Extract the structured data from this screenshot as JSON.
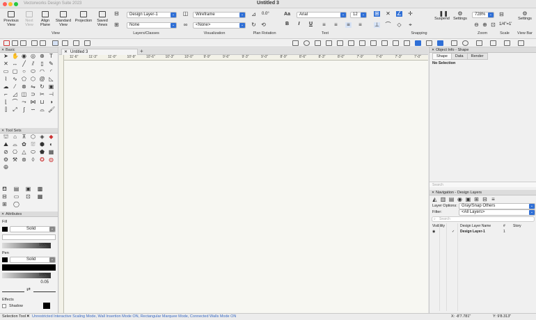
{
  "window": {
    "app_title": "Vectorworks Design Suite 2023",
    "doc_title": "Untitled 3"
  },
  "toolbar": {
    "previous_view": "Previous View",
    "next_view": "Next View",
    "align_plane": "Align Plane",
    "standard_view": "Standard View",
    "projection": "Projection",
    "saved_views": "Saved Views",
    "view_label": "View",
    "design_layer": "Design Layer-1",
    "class_value": "None",
    "layers_classes_label": "Layers/Classes",
    "render_mode": "Wireframe",
    "projection_value": "<None>",
    "visualization_label": "Visualization",
    "plan_rotation_value": "0.0°",
    "plan_rotation_label": "Plan Rotation",
    "font_name": "Arial",
    "font_size": "12",
    "text_label": "Text",
    "snapping_label": "Snapping",
    "suspend": "Suspend",
    "settings": "Settings",
    "zoom_value": "728%",
    "zoom_label": "Zoom",
    "scale_value": "1/4\"=1'",
    "scale_label": "Scale",
    "settings_right": "Settings",
    "view_bar_label": "View Bar"
  },
  "palettes": {
    "basic": "Basic",
    "tool_sets": "Tool Sets",
    "attributes": "Attributes",
    "fill_label": "Fill",
    "fill_style": "Solid",
    "fill_opacity": "100%",
    "pen_label": "Pen",
    "pen_style": "Solid",
    "pen_opacity": "100%",
    "line_weight": "0.05",
    "effects_label": "Effects",
    "shadow_label": "Shadow"
  },
  "document": {
    "tab": "Untitled 3",
    "ruler_ticks": [
      "11'-6\"",
      "11'-3\"",
      "11'-0\"",
      "10'-9\"",
      "10'-6\"",
      "10'-3\"",
      "10'-0\"",
      "9'-9\"",
      "9'-6\"",
      "9'-3\"",
      "9'-0\"",
      "8'-9\"",
      "8'-6\"",
      "8'-3\"",
      "8'-0\"",
      "7'-9\"",
      "7'-6\"",
      "7'-3\"",
      "7'-0\""
    ]
  },
  "object_info": {
    "title": "Object Info - Shape",
    "tabs": [
      "Shape",
      "Data",
      "Render"
    ],
    "selection": "No Selection",
    "search_placeholder": "Search"
  },
  "navigation": {
    "title": "Navigation - Design Layers",
    "layer_options_label": "Layer Options:",
    "layer_options_value": "Gray/Snap Others",
    "filter_label": "Filter:",
    "filter_value": "<All Layers>",
    "search_placeholder": "Search",
    "columns": [
      "Visibility",
      "Design Layer Name",
      "#",
      "Story"
    ],
    "rows": [
      {
        "name": "Design Layer-1",
        "number": "1",
        "story": ""
      }
    ]
  },
  "statusbar": {
    "tool": "Selection Tool",
    "modes": "Unrestricted Interactive Scaling Mode, Wall Insertion Mode ON, Rectangular Marquee Mode, Connected Walls Mode ON",
    "x": "X: -8'7.781\"",
    "y": "Y: 9'8.313\""
  },
  "colors": {
    "accent": "#2f6fd6",
    "canvas": "#f7f7f2",
    "swatch": "#000000"
  }
}
